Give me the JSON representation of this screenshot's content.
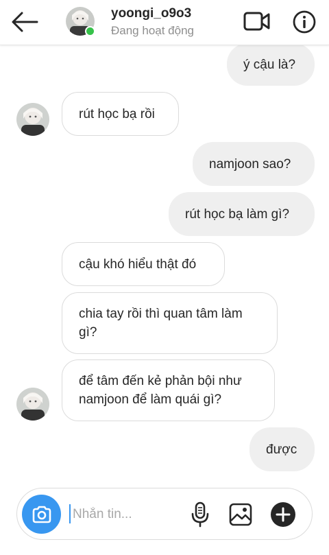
{
  "header": {
    "username": "yoongi_o9o3",
    "status": "Đang hoạt động"
  },
  "messages": [
    {
      "text": "ý cậu là?",
      "direction": "outgoing"
    },
    {
      "text": "rút học bạ rồi",
      "direction": "incoming"
    },
    {
      "text": "namjoon sao?",
      "direction": "outgoing"
    },
    {
      "text": "rút học bạ làm gì?",
      "direction": "outgoing"
    },
    {
      "text": "cậu khó hiểu thật đó",
      "direction": "incoming"
    },
    {
      "text": "chia tay rồi thì quan tâm làm gì?",
      "direction": "incoming"
    },
    {
      "text": "để tâm đến kẻ phản bội như namjoon để làm quái gì?",
      "direction": "incoming"
    },
    {
      "text": "được",
      "direction": "outgoing"
    }
  ],
  "composer": {
    "placeholder": "Nhắn tin..."
  },
  "icons": {
    "back": "arrow-left-icon",
    "video": "video-camera-icon",
    "info": "info-icon",
    "camera": "camera-icon",
    "mic": "microphone-icon",
    "gallery": "image-gallery-icon",
    "plus": "plus-circle-icon"
  },
  "colors": {
    "accent": "#3897f0",
    "online": "#36c24a",
    "outgoing_bubble": "#efefef",
    "incoming_border": "#dbdbdb"
  }
}
